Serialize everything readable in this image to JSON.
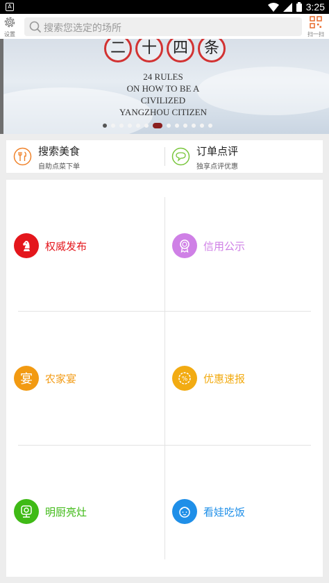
{
  "status_bar": {
    "notification": "A",
    "time": "3:25"
  },
  "top_bar": {
    "settings_label": "设置",
    "search_placeholder": "搜索您选定的场所",
    "scan_label": "扫一扫"
  },
  "banner": {
    "title_chars": [
      "二",
      "十",
      "四",
      "条"
    ],
    "subtitle_lines": [
      "24 RULES",
      "ON HOW TO BE A CIVILIZED",
      "YANGZHOU CITIZEN"
    ],
    "page_count": 13,
    "active_page": 1
  },
  "quick_actions": [
    {
      "title": "搜索美食",
      "subtitle": "自助点菜下单",
      "icon": "fork-knife-icon",
      "color": "#f0832b"
    },
    {
      "title": "订单点评",
      "subtitle": "独享点评优惠",
      "icon": "chat-bubble-icon",
      "color": "#79c63c"
    }
  ],
  "grid_items": [
    {
      "label": "权威发布",
      "icon": "chess-knight-icon",
      "color": "#e4161c"
    },
    {
      "label": "信用公示",
      "icon": "medal-icon",
      "color": "#cf80e6"
    },
    {
      "label": "农家宴",
      "icon": "banquet-icon",
      "color": "#f29a12"
    },
    {
      "label": "优惠速报",
      "icon": "discount-icon",
      "color": "#f2ab12"
    },
    {
      "label": "明厨亮灶",
      "icon": "camera-icon",
      "color": "#3fba16"
    },
    {
      "label": "看娃吃饭",
      "icon": "child-face-icon",
      "color": "#1f8fe8"
    }
  ]
}
